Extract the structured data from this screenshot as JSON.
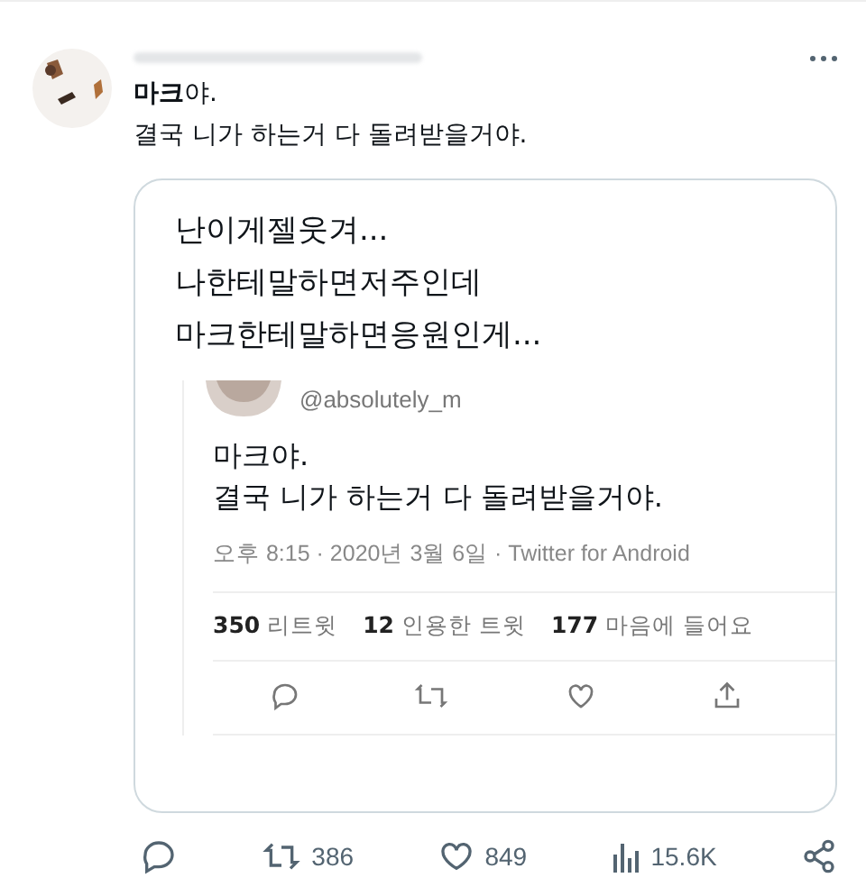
{
  "tweet": {
    "text": "**마크**야.",
    "text_2": "결국 니가 하는거 다 돌려받을거야.",
    "quote": {
      "lines": [
        "난이게젤웃겨...",
        "나한테말하면저주인데",
        "마크한테말하면응원인게..."
      ],
      "screenshot": {
        "handle": "@absolutely_m",
        "lines": [
          "마크야.",
          "결국 니가 하는거 다 돌려받을거야."
        ],
        "meta": "오후 8:15 · 2020년 3월 6일 · Twitter for Android",
        "stats": [
          {
            "count": "350",
            "label": "리트윗"
          },
          {
            "count": "12",
            "label": "인용한 트윗"
          },
          {
            "count": "177",
            "label": "마음에 들어요"
          }
        ]
      }
    },
    "actions": [
      {
        "kind": "reply"
      },
      {
        "kind": "retweet",
        "count": "386"
      },
      {
        "kind": "like",
        "count": "849"
      },
      {
        "kind": "views",
        "count": "15.6K"
      },
      {
        "kind": "share"
      }
    ]
  }
}
